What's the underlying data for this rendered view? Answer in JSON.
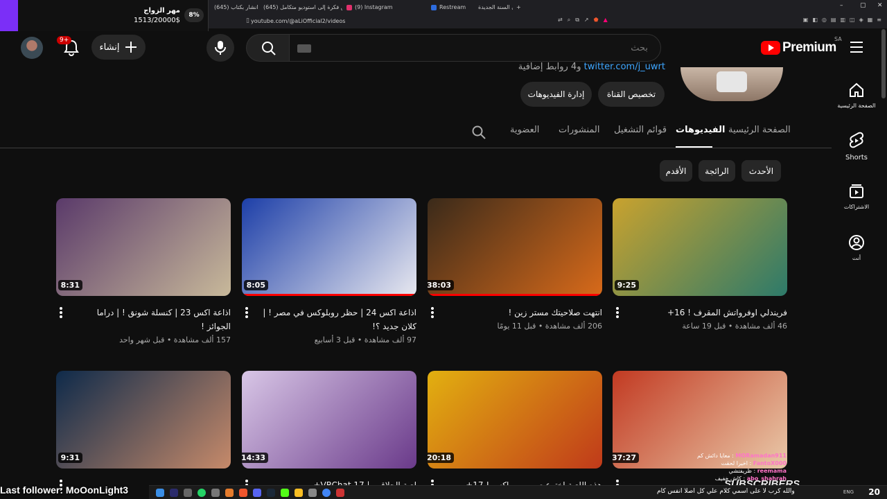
{
  "browser": {
    "tabs": [
      {
        "label": "(645) مشيخة انشار بكتاب",
        "color": "#ff0000"
      },
      {
        "label": "(645) من فكرة إلى استوديو متكامل",
        "color": "#ff0000"
      },
      {
        "label": "(9) Instagram",
        "color": "#e1306c"
      },
      {
        "label": "Restream",
        "color": "#2d6cdf"
      },
      {
        "label": "اول بث في السنة الجديدة",
        "color": "#ff0000"
      }
    ],
    "new_tab": "+",
    "url": "youtube.com/@aLiOfficial2/videos",
    "window_controls": [
      "–",
      "▢",
      "✕"
    ]
  },
  "goal_widget": {
    "title": "مهر الزواج",
    "amount": "1513/20000$",
    "percent": "8%",
    "progress": 0.08
  },
  "header": {
    "brand": "Premium",
    "country": "SA",
    "search_placeholder": "بحث",
    "create_label": "إنشاء",
    "notifications_badge": "9+"
  },
  "sidebar": [
    {
      "id": "home",
      "label": "الصفحة الرئيسية",
      "icon": "home-icon"
    },
    {
      "id": "shorts",
      "label": "Shorts",
      "icon": "shorts-icon"
    },
    {
      "id": "subscriptions",
      "label": "الاشتراكات",
      "icon": "subscriptions-icon"
    },
    {
      "id": "you",
      "label": "أنت",
      "icon": "you-icon"
    }
  ],
  "channel": {
    "links_text": "twitter.com/j_uwrt",
    "links_more": "و4 روابط إضافية",
    "customize_button": "تخصيص القناة",
    "manage_videos_button": "إدارة الفيديوهات"
  },
  "tabs": [
    {
      "label": "الصفحة الرئيسية",
      "active": false
    },
    {
      "label": "الفيديوهات",
      "active": true
    },
    {
      "label": "قوائم التشغيل",
      "active": false
    },
    {
      "label": "المنشورات",
      "active": false
    },
    {
      "label": "العضوية",
      "active": false
    }
  ],
  "chips": [
    {
      "label": "الأحدث",
      "selected": false
    },
    {
      "label": "الرائجة",
      "selected": false
    },
    {
      "label": "الأقدم",
      "selected": false
    }
  ],
  "videos": [
    {
      "title": "فريندلي اوفرواتش المقرف ! 16+",
      "meta": "46 ألف مشاهدة • قبل 19 ساعة",
      "duration": "9:25",
      "progress": 0.0,
      "c1": "#c9a22e",
      "c2": "#2d7a6a"
    },
    {
      "title": "انتهت صلاحيتك مستر زين !",
      "meta": "206 ألف مشاهدة • قبل 11 يومًا",
      "duration": "38:03",
      "progress": 1.0,
      "c1": "#3a2a1a",
      "c2": "#d86a1a"
    },
    {
      "title": "اذاعة اكس 24 | حظر روبلوكس في مصر ! | كلان جديد ؟!",
      "meta": "97 ألف مشاهدة • قبل 3 أسابيع",
      "duration": "8:05",
      "progress": 1.0,
      "c1": "#1d3fa8",
      "c2": "#e8e8ef"
    },
    {
      "title": "اذاعة اكس 23 | كنسلة شونق ! | دراما الجوائز !",
      "meta": "157 ألف مشاهدة • قبل شهر واحد",
      "duration": "8:31",
      "progress": 0.0,
      "c1": "#5a3a6a",
      "c2": "#c8b99a"
    },
    {
      "title": "",
      "meta": "",
      "duration": "37:27",
      "progress": 0.0,
      "c1": "#c23a22",
      "c2": "#e9c9a9"
    },
    {
      "title": "هذه اللعبة اخترعت من ...ماكس ! 17+",
      "meta": "",
      "duration": "20:18",
      "progress": 0.0,
      "c1": "#e2b010",
      "c2": "#c03a1a"
    },
    {
      "title": "لعبة الحلاقين | VRChat 17+",
      "meta": "",
      "duration": "14:33",
      "progress": 0.0,
      "c1": "#d8c6e6",
      "c2": "#6a3a8a"
    },
    {
      "title": "",
      "meta": "",
      "duration": "9:31",
      "progress": 0.0,
      "c1": "#0e2a4a",
      "c2": "#c68a6a"
    }
  ],
  "overlays": {
    "last_follower": "Last follower: MoOonLight3",
    "subscribers_banner": "SUBSCRIBERS",
    "chat": [
      {
        "name": "MORamadan911",
        "text": "معايا دائش كم"
      },
      {
        "name": "FantoX000",
        "text": "اخيرا لحقت"
      },
      {
        "name": "reemama",
        "text": "ظريفتشي"
      },
      {
        "name": "abo_shahrah",
        "text": "كاش خفيف"
      }
    ],
    "bottom_text": "والله كرب لا على اسمي كلام علي كل اصلا انفس كام",
    "clock": "20",
    "lang": "ENG"
  }
}
